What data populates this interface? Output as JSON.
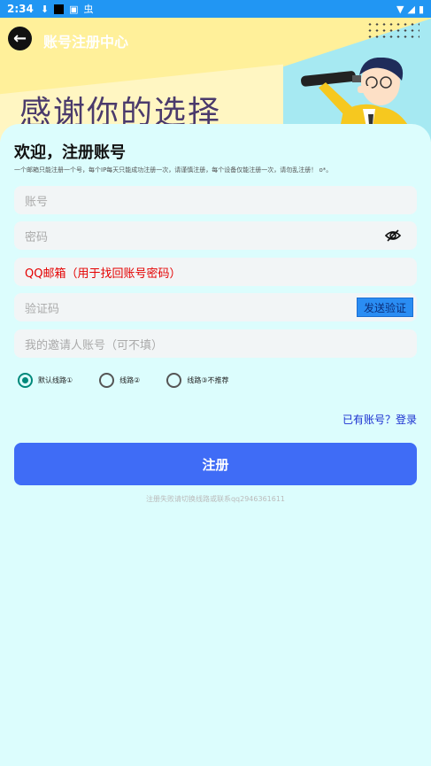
{
  "status_bar": {
    "time": "2:34",
    "bug_icon": "虫"
  },
  "header": {
    "title": "账号注册中心",
    "banner": "感谢你的选择"
  },
  "form": {
    "welcome": "欢迎，注册账号",
    "note": "一个邮箱只能注册一个号，每个IP每天只能成功注册一次，请谨慎注册，每个设备仅能注册一次，请勿乱注册！ o*。",
    "account_placeholder": "账号",
    "password_placeholder": "密码",
    "email_placeholder": "QQ邮箱（用于找回账号密码）",
    "code_placeholder": "验证码",
    "send_code": "发送验证",
    "invite_placeholder": "我的邀请人账号（可不填）"
  },
  "routes": [
    {
      "label": "默认线路①",
      "selected": true
    },
    {
      "label": "线路②",
      "selected": false
    },
    {
      "label": "线路③不推荐",
      "selected": false
    }
  ],
  "login_link": "已有账号？登录",
  "register_button": "注册",
  "footer_note": "注册失败请切换线路或联系qq2946361611",
  "colors": {
    "status": "#2196f3",
    "primary": "#3f6cf6",
    "radio": "#00897b",
    "error": "#e40000"
  }
}
